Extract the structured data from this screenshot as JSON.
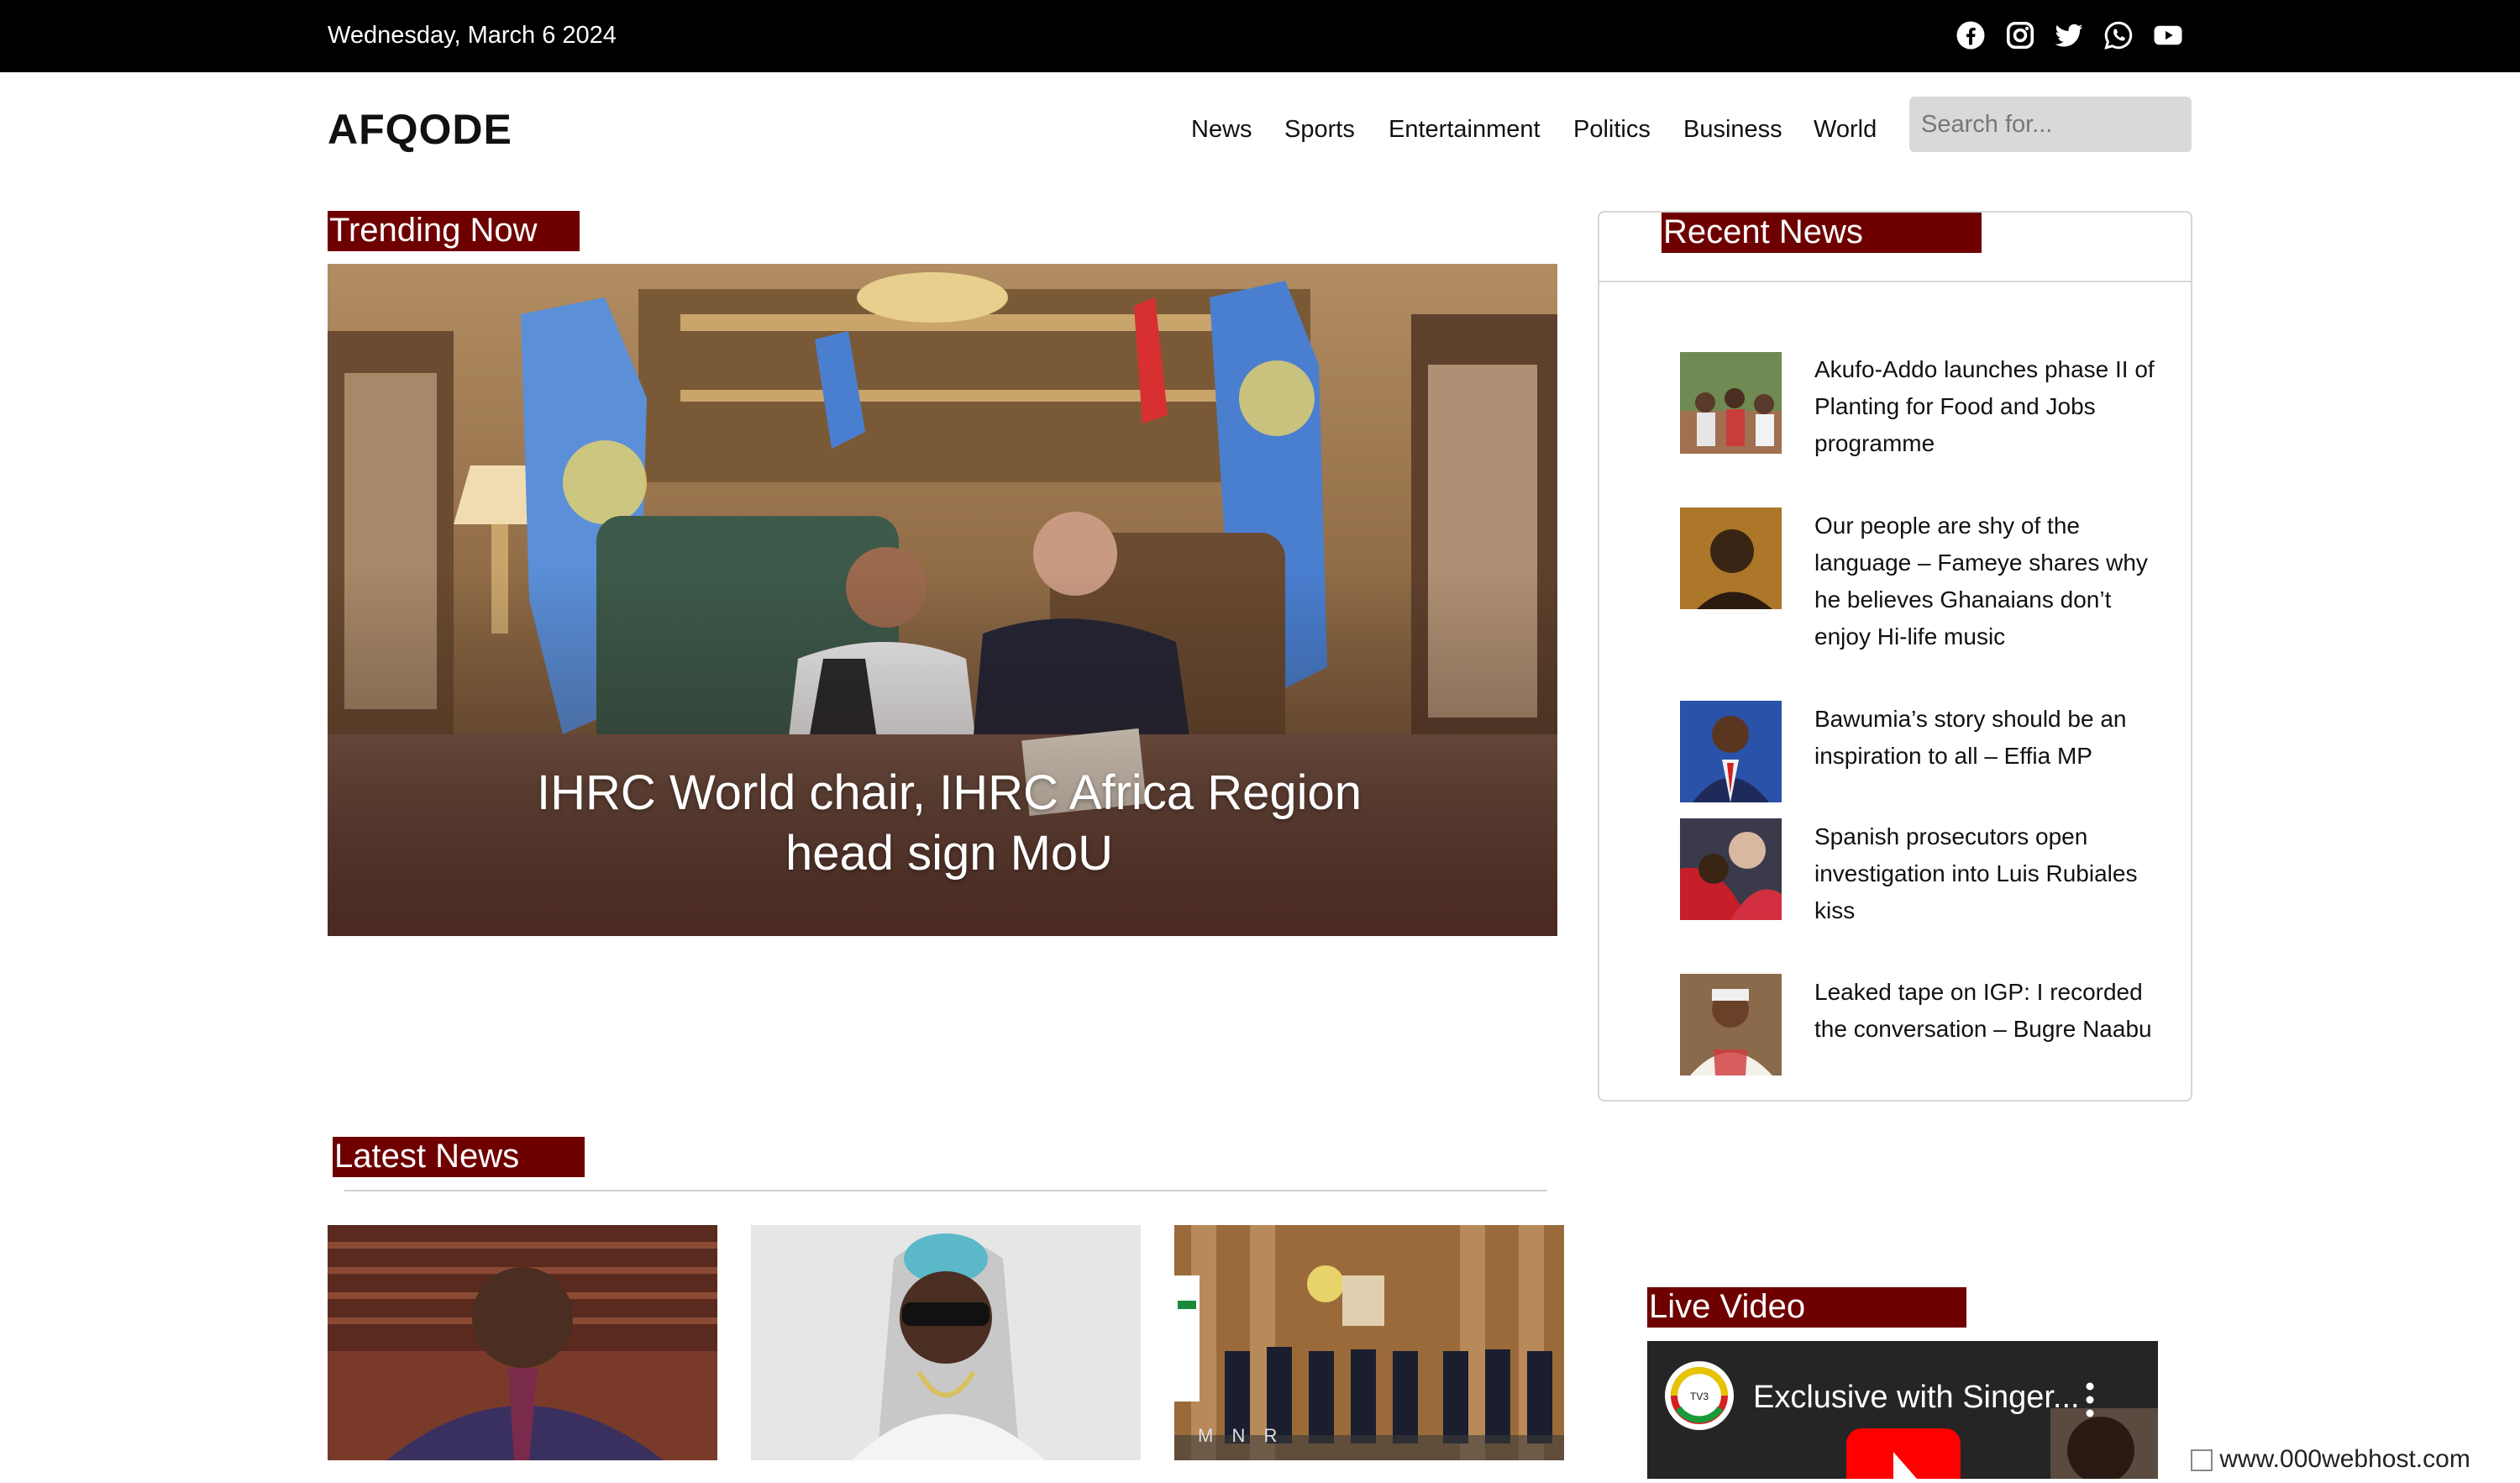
{
  "topbar": {
    "date": "Wednesday, March 6 2024",
    "social_icons": [
      "facebook-icon",
      "instagram-icon",
      "twitter-icon",
      "whatsapp-icon",
      "youtube-icon"
    ]
  },
  "header": {
    "logo": "AFQODE",
    "nav": [
      "News",
      "Sports",
      "Entertainment",
      "Politics",
      "Business",
      "World"
    ],
    "search_placeholder": "Search for..."
  },
  "trending": {
    "label": "Trending Now",
    "headline": "IHRC World chair, IHRC Africa Region head sign MoU"
  },
  "recent": {
    "label": "Recent News",
    "items": [
      "Akufo-Addo launches phase II of Planting for Food and Jobs programme",
      "Our people are shy of the language – Fameye shares why he believes Ghanaians don’t enjoy Hi-life music",
      "Bawumia’s story should be an inspiration to all – Effia MP",
      "Spanish prosecutors open investigation into Luis Rubiales kiss",
      "Leaked tape on IGP: I recorded the conversation – Bugre Naabu"
    ]
  },
  "latest": {
    "label": "Latest News",
    "banner_text": "M N R"
  },
  "live": {
    "label": "Live Video",
    "video_title": "Exclusive with Singer..."
  },
  "footer_badge": "www.000webhost.com",
  "colors": {
    "accent": "#6e0000",
    "topbar_bg": "#000000",
    "search_bg": "#d9d9d9"
  }
}
